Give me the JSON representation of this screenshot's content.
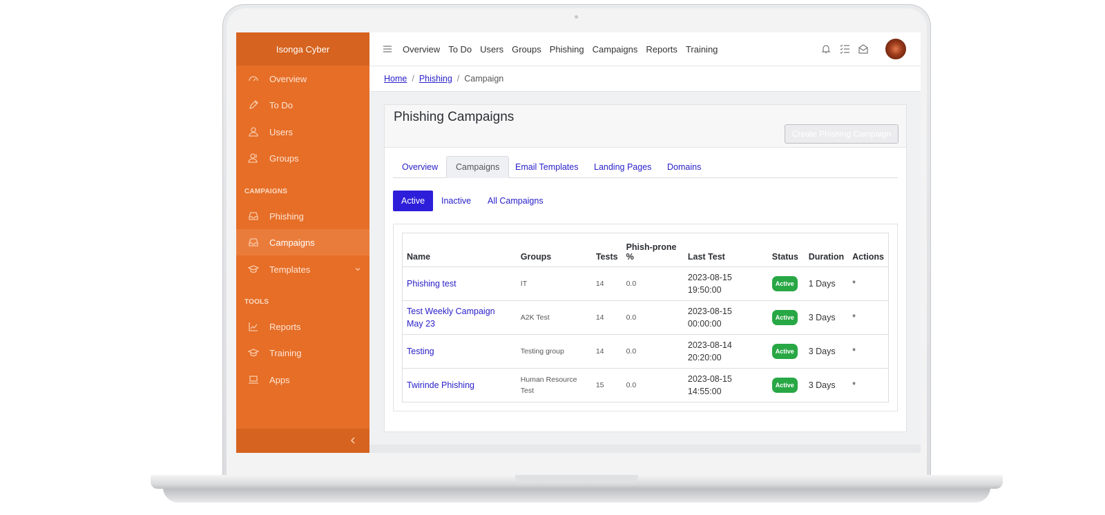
{
  "brand": "Isonga Cyber",
  "sidebar": {
    "items": [
      {
        "label": "Overview",
        "icon": "dashboard-icon"
      },
      {
        "label": "To Do",
        "icon": "pencil-icon"
      },
      {
        "label": "Users",
        "icon": "user-icon"
      },
      {
        "label": "Groups",
        "icon": "group-icon"
      }
    ],
    "campaigns_section": "CAMPAIGNS",
    "campaign_items": [
      {
        "label": "Phishing",
        "icon": "inbox-icon"
      },
      {
        "label": "Campaigns",
        "icon": "inbox-icon",
        "active": true
      },
      {
        "label": "Templates",
        "icon": "graduation-cap-icon"
      }
    ],
    "tools_section": "TOOLS",
    "tool_items": [
      {
        "label": "Reports",
        "icon": "chart-line-icon"
      },
      {
        "label": "Training",
        "icon": "graduation-cap-icon"
      },
      {
        "label": "Apps",
        "icon": "laptop-icon"
      }
    ]
  },
  "topnav": [
    "Overview",
    "To Do",
    "Users",
    "Groups",
    "Phishing",
    "Campaigns",
    "Reports",
    "Training"
  ],
  "breadcrumb": {
    "home": "Home",
    "phishing": "Phishing",
    "current": "Campaign"
  },
  "card": {
    "title": "Phishing Campaigns",
    "create_button": "Create Phishing Campaign",
    "tabs": [
      "Overview",
      "Campaigns",
      "Email Templates",
      "Landing Pages",
      "Domains"
    ],
    "active_tab": "Campaigns",
    "filters": [
      "Active",
      "Inactive",
      "All Campaigns"
    ],
    "active_filter": "Active"
  },
  "table": {
    "headers": {
      "name": "Name",
      "groups": "Groups",
      "tests": "Tests",
      "phish_prone_1": "Phish-prone",
      "phish_prone_2": "%",
      "last_test": "Last Test",
      "status": "Status",
      "duration": "Duration",
      "actions": "Actions"
    },
    "rows": [
      {
        "name": "Phishing test",
        "groups": "IT",
        "tests": "14",
        "phish": "0.0",
        "date": "2023-08-15",
        "time": "19:50:00",
        "status": "Active",
        "duration": "1 Days",
        "actions": "*"
      },
      {
        "name": "Test Weekly Campaign May 23",
        "groups": "A2K Test",
        "tests": "14",
        "phish": "0.0",
        "date": "2023-08-15",
        "time": "00:00:00",
        "status": "Active",
        "duration": "3 Days",
        "actions": "*"
      },
      {
        "name": "Testing",
        "groups": "Testing group",
        "tests": "14",
        "phish": "0.0",
        "date": "2023-08-14",
        "time": "20:20:00",
        "status": "Active",
        "duration": "3 Days",
        "actions": "*"
      },
      {
        "name": "Twirinde Phishing",
        "groups": "Human Resource Test",
        "tests": "15",
        "phish": "0.0",
        "date": "2023-08-15",
        "time": "14:55:00",
        "status": "Active",
        "duration": "3 Days",
        "actions": "*"
      }
    ]
  },
  "colors": {
    "sidebar": "#e66e27",
    "brand_bar": "#d6631f",
    "link": "#2a20c9",
    "active_filter": "#2d1fd9",
    "status_active": "#28a745"
  }
}
